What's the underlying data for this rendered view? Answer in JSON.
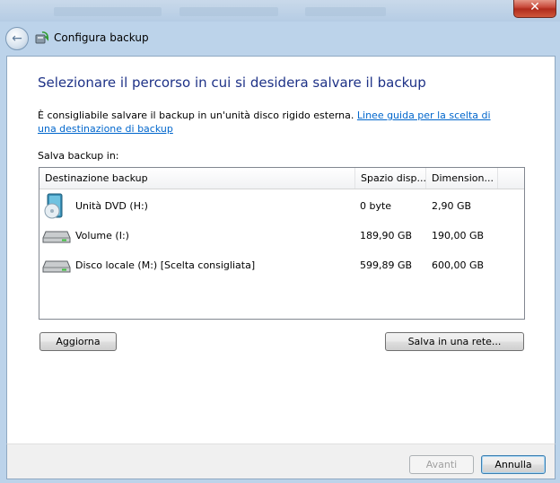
{
  "window": {
    "title": "Configura backup",
    "close_glyph": "✕",
    "back_glyph": "←"
  },
  "main": {
    "heading": "Selezionare il percorso in cui si desidera salvare il backup",
    "description": "È consigliabile salvare il backup in un'unità disco rigido esterna. ",
    "link": "Linee guida per la scelta di una destinazione di backup",
    "save_label": "Salva backup in:"
  },
  "table": {
    "columns": [
      "Destinazione backup",
      "Spazio disp...",
      "Dimension..."
    ],
    "rows": [
      {
        "icon": "dvd-drive-icon",
        "name": "Unità DVD (H:)",
        "free": "0 byte",
        "size": "2,90 GB"
      },
      {
        "icon": "hard-disk-icon",
        "name": "Volume (I:)",
        "free": "189,90 GB",
        "size": "190,00 GB"
      },
      {
        "icon": "hard-disk-icon",
        "name": "Disco locale (M:) [Scelta consigliata]",
        "free": "599,89 GB",
        "size": "600,00 GB"
      }
    ]
  },
  "buttons": {
    "refresh": "Aggiorna",
    "network": "Salva in una rete...",
    "next": "Avanti",
    "cancel": "Annulla"
  },
  "colors": {
    "heading": "#1e3287",
    "link": "#0066cc",
    "close": "#c8493a"
  }
}
